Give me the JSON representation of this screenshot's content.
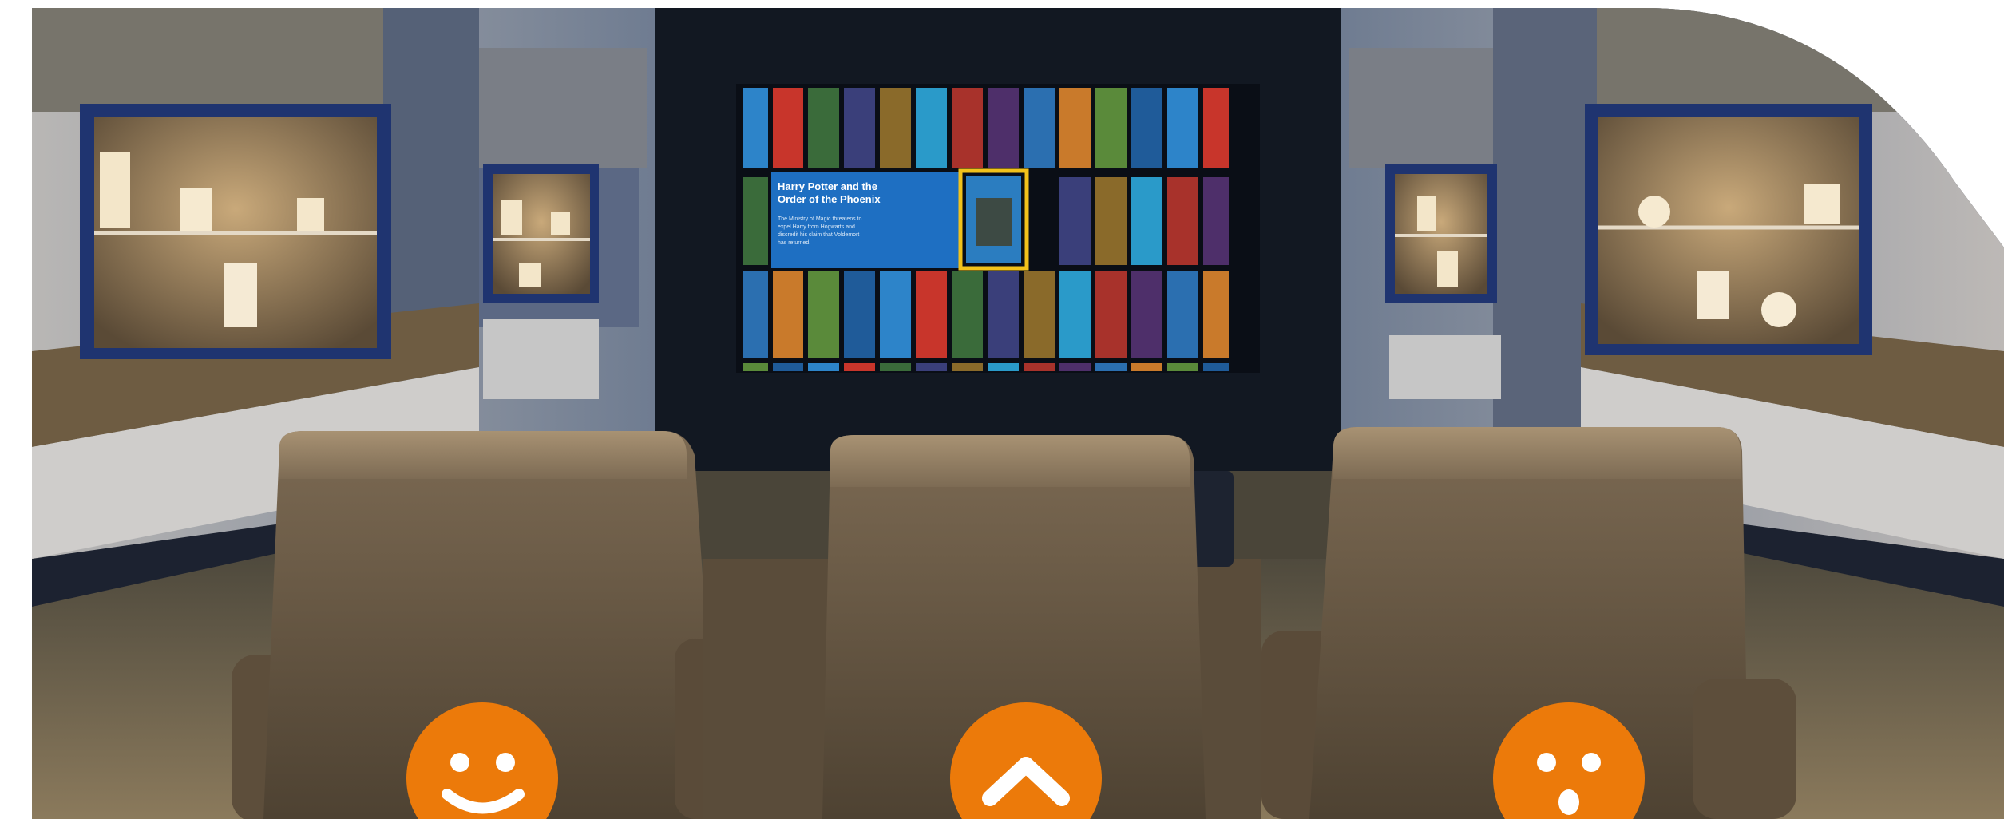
{
  "scene": {
    "screen_feature": {
      "title_line1": "Harry Potter and the",
      "title_line2": "Order of the Phoenix",
      "description_lines": [
        "The Ministry of Magic threatens to",
        "expel Harry from Hogwarts and",
        "discredit his claim that Voldemort",
        "has returned."
      ]
    },
    "colors": {
      "accent_orange": "#ec7a0a",
      "feature_panel_blue": "#1e6fc2",
      "selection_yellow": "#f2c21b",
      "screen_wall_dark": "#121822"
    }
  },
  "overlay_icons": [
    "smile-face-icon",
    "chevron-up-icon",
    "surprised-face-icon"
  ]
}
